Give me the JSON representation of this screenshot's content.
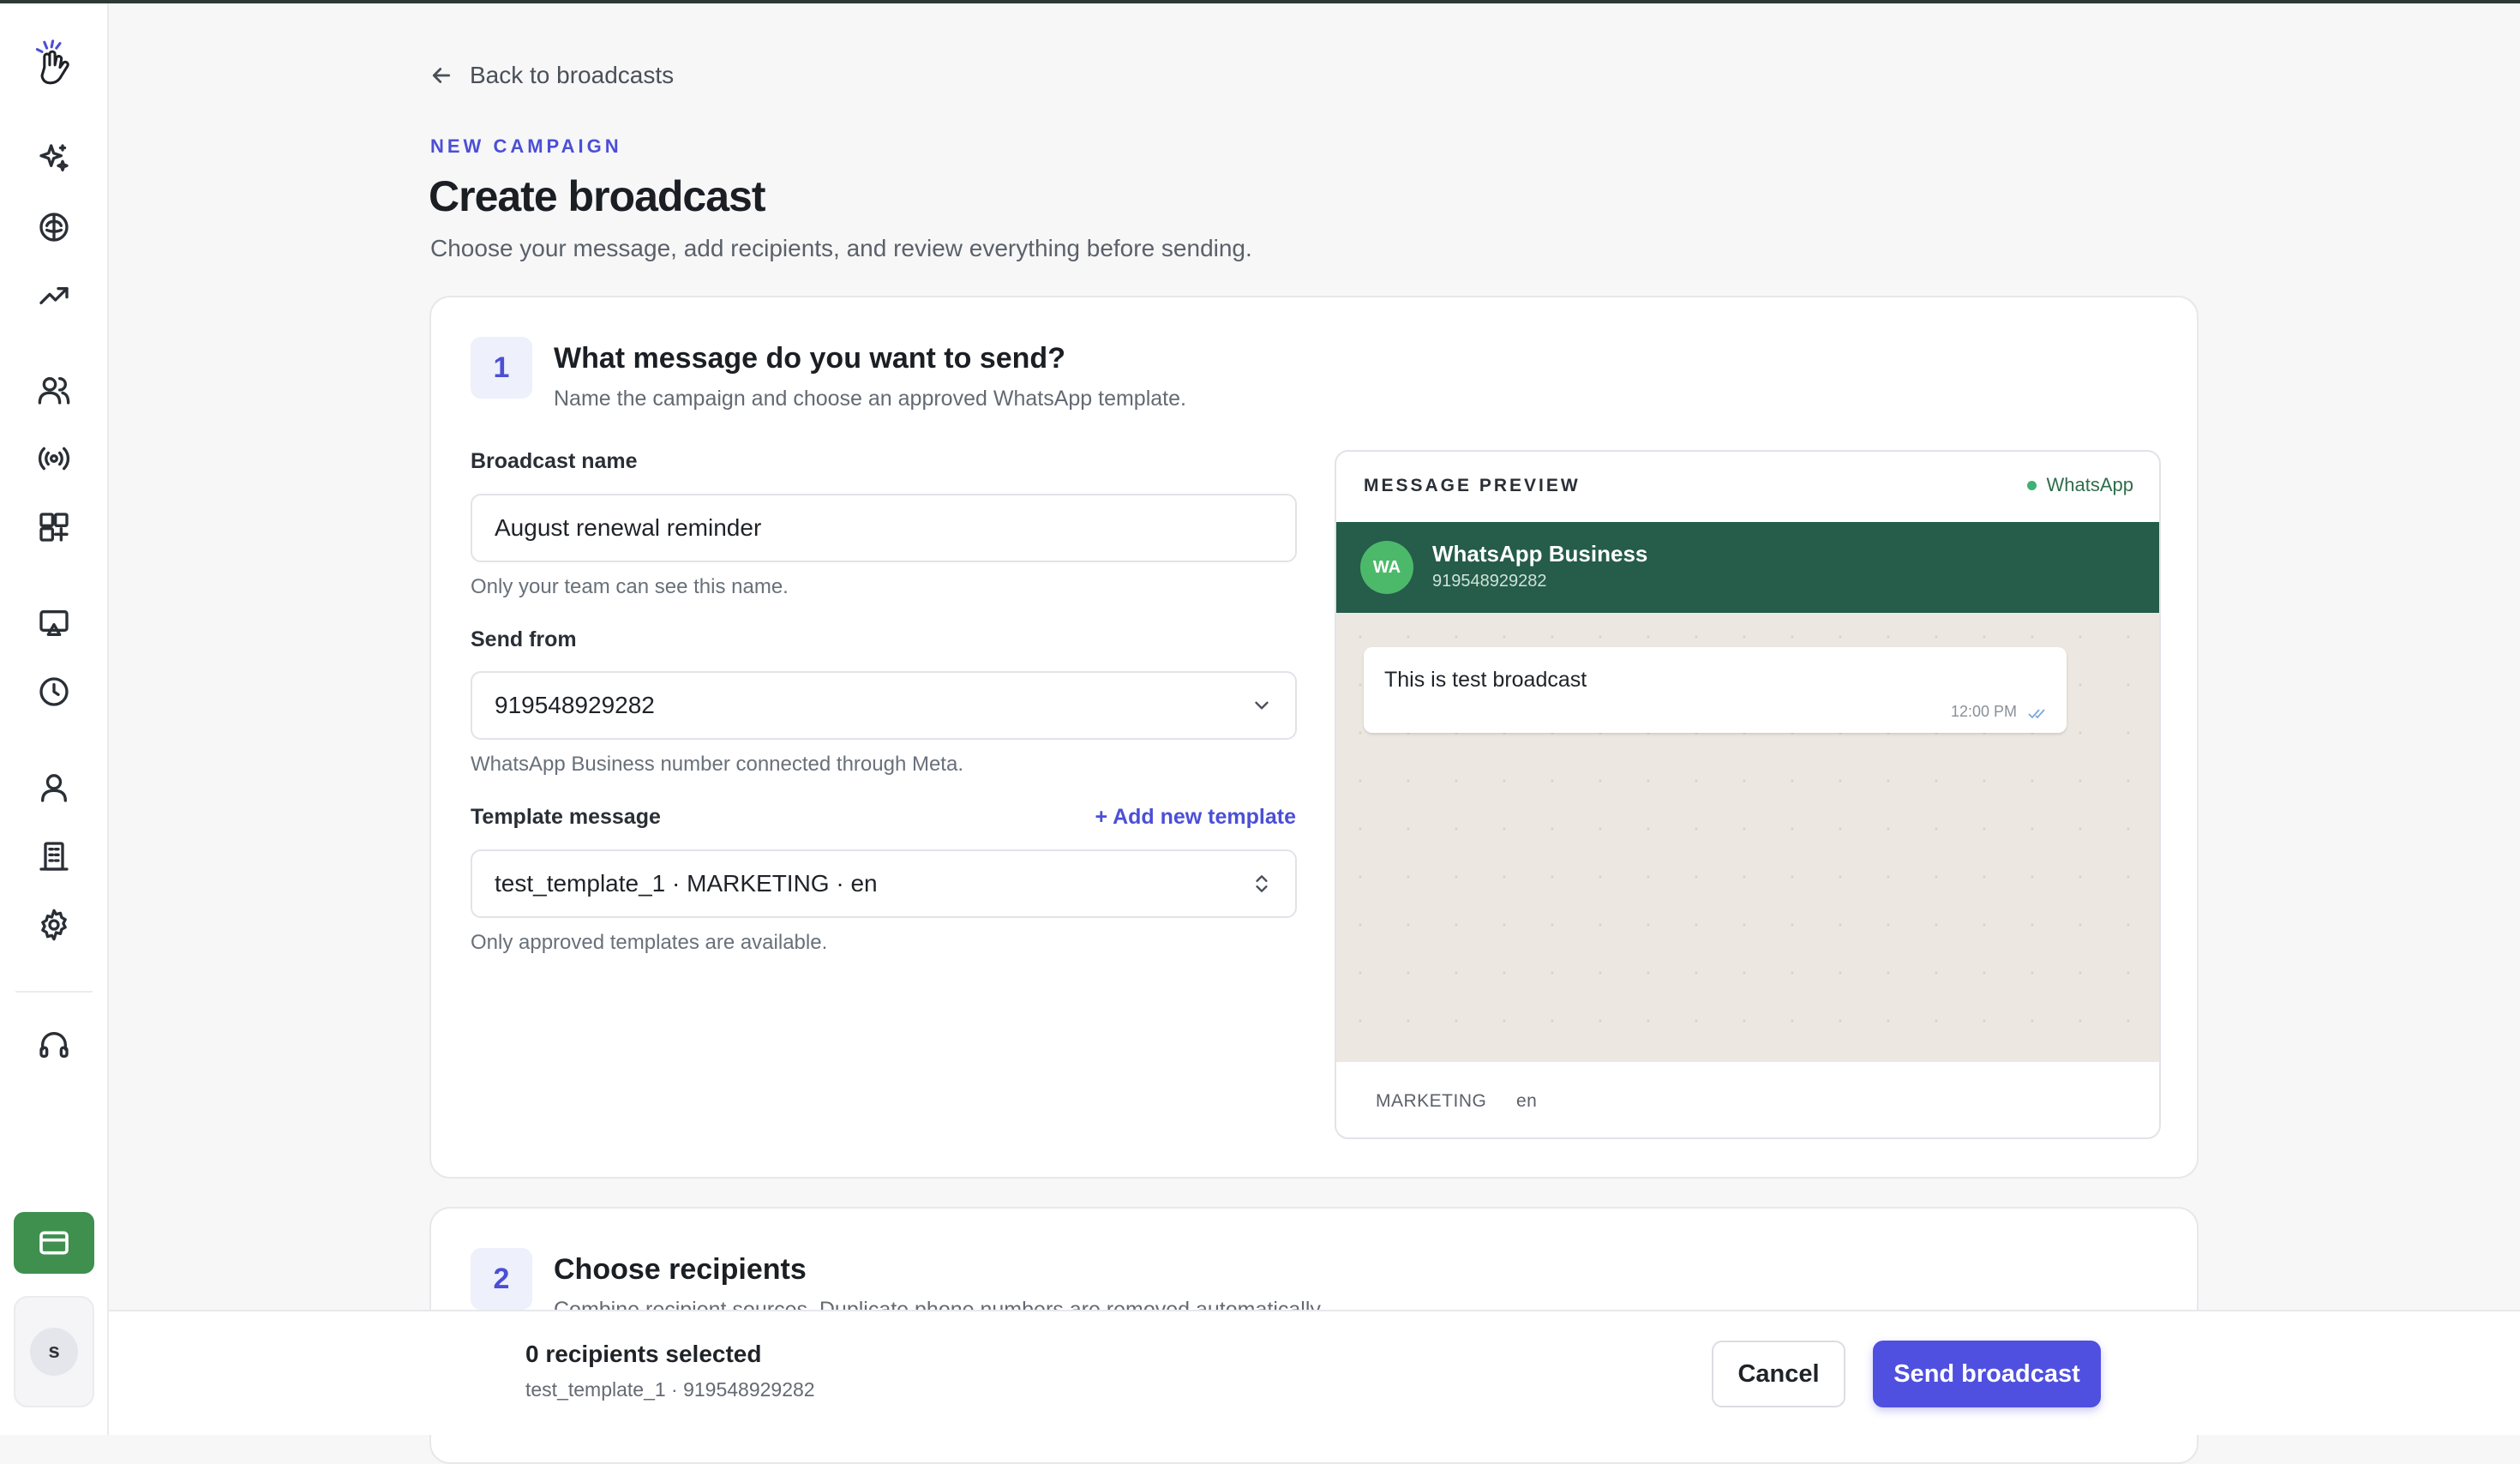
{
  "sidebar": {
    "items": [
      {
        "icon": "sparkles-icon"
      },
      {
        "icon": "brain-icon"
      },
      {
        "icon": "trending-up-icon"
      },
      {
        "icon": "users-icon"
      },
      {
        "icon": "broadcast-icon"
      },
      {
        "icon": "grid-plus-icon"
      },
      {
        "icon": "presentation-icon"
      },
      {
        "icon": "clock-icon"
      },
      {
        "icon": "user-icon"
      },
      {
        "icon": "building-icon"
      },
      {
        "icon": "gear-icon"
      },
      {
        "icon": "headset-icon"
      }
    ],
    "billing_icon": "credit-card-icon",
    "user_initial": "s"
  },
  "header": {
    "back_label": "Back to broadcasts",
    "eyebrow": "NEW CAMPAIGN",
    "title": "Create broadcast",
    "subtitle": "Choose your message, add recipients, and review everything before sending."
  },
  "step1": {
    "number": "1",
    "title": "What message do you want to send?",
    "subtitle": "Name the campaign and choose an approved WhatsApp template.",
    "broadcast_name": {
      "label": "Broadcast name",
      "value": "August renewal reminder",
      "hint": "Only your team can see this name."
    },
    "send_from": {
      "label": "Send from",
      "value": "919548929282",
      "hint": "WhatsApp Business number connected through Meta."
    },
    "template": {
      "label": "Template message",
      "add_label": "+ Add new template",
      "value": "test_template_1 · MARKETING · en",
      "hint": "Only approved templates are available."
    }
  },
  "preview": {
    "label": "MESSAGE PREVIEW",
    "channel": "WhatsApp",
    "avatar_text": "WA",
    "business_name": "WhatsApp Business",
    "business_number": "919548929282",
    "message": "This is test broadcast",
    "time": "12:00 PM",
    "category": "MARKETING",
    "language": "en"
  },
  "step2": {
    "number": "2",
    "title": "Choose recipients",
    "subtitle": "Combine recipient sources. Duplicate phone numbers are removed automatically."
  },
  "footer": {
    "count": "0 recipients selected",
    "meta": "test_template_1 · 919548929282",
    "cancel_label": "Cancel",
    "send_label": "Send broadcast"
  },
  "colors": {
    "accent": "#4f4fe0",
    "whatsapp_bar": "#255c4a",
    "billing": "#3f8f4f"
  }
}
